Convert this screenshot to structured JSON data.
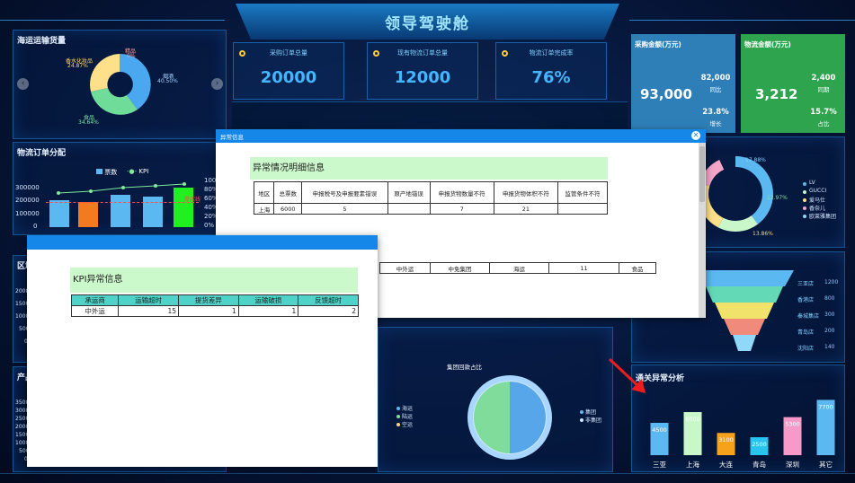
{
  "header": {
    "title": "领导驾驶舱"
  },
  "kpis": [
    {
      "label": "采购订单总量",
      "value": "20000"
    },
    {
      "label": "现有物流订单总量",
      "value": "12000"
    },
    {
      "label": "物流订单完成率",
      "value": "76%"
    }
  ],
  "money": {
    "purchase": {
      "title": "采购金额(万元)",
      "main": "93,000",
      "v1": "82,000",
      "c1": "同比",
      "v2": "23.8%",
      "c2": "增长",
      "color": "#2e7fb8"
    },
    "logistics": {
      "title": "物流金额(万元)",
      "main": "3,212",
      "v1": "2,400",
      "c1": "同期",
      "v2": "15.7%",
      "c2": "占比",
      "color": "#2ea44f"
    }
  },
  "shipping": {
    "title": "海运运输货量",
    "labels": [
      {
        "name": "精品",
        "pct": "0%"
      },
      {
        "name": "香水化妆品",
        "pct": "24.87%"
      },
      {
        "name": "烟酒",
        "pct": "40.50%"
      },
      {
        "name": "食品",
        "pct": "34.64%"
      }
    ]
  },
  "order_dist": {
    "title": "物流订单分配",
    "legend": [
      "票数",
      "KPI"
    ],
    "y_left": [
      "300000",
      "200000",
      "100000",
      "0"
    ],
    "y_right": [
      "100",
      "80%",
      "60%",
      "40%",
      "20%",
      "0%"
    ],
    "marker": "警戒线"
  },
  "cut_labels": {
    "region": "区域",
    "product": "产品"
  },
  "left_ticks_mid": [
    "2000",
    "1500",
    "1000",
    "500",
    "0"
  ],
  "left_ticks_bottom": [
    "3500",
    "3000",
    "2500",
    "2000",
    "1500",
    "1000",
    "500",
    "0"
  ],
  "brand_legend": [
    "LV",
    "GUCCI",
    "爱马仕",
    "香奈儿",
    "欧莱雅集团"
  ],
  "brand_pcts": [
    "17.88%",
    "12.97%",
    "13.86%"
  ],
  "funnel": [
    {
      "name": "三亚店",
      "value": "1200",
      "color": "#5cb8f0"
    },
    {
      "name": "香港店",
      "value": "800",
      "color": "#64d9b6"
    },
    {
      "name": "秦城集店",
      "value": "300",
      "color": "#f0e26a"
    },
    {
      "name": "青岛店",
      "value": "200",
      "color": "#f08a7a"
    },
    {
      "name": "沈阳店",
      "value": "140",
      "color": "#8fd8f8"
    }
  ],
  "customs": {
    "title": "通关异常分析",
    "chart_data": {
      "type": "bar",
      "title": "通关异常分析",
      "categories": [
        "三亚",
        "上海",
        "大连",
        "青岛",
        "深圳",
        "其它"
      ],
      "values": [
        4500,
        6000,
        3100,
        2500,
        5300,
        7700
      ],
      "colors": [
        "#5cb8f0",
        "#c9f7c9",
        "#f7a21b",
        "#28c4ee",
        "#f59ac9",
        "#5cb8f0"
      ],
      "ylim": [
        0,
        8000
      ]
    }
  },
  "group_pie": {
    "title": "集团回款占比",
    "left_legend": [
      "海运",
      "陆运",
      "空运"
    ],
    "right_legend": [
      "集团",
      "非集团"
    ]
  },
  "dialog_exception": {
    "bar_title": "异常信息",
    "section": "异常情况明细信息",
    "columns": [
      "地区",
      "总票数",
      "申报税号及申报要素错误",
      "原产地错误",
      "申报货物数量不符",
      "申报货物体积不符",
      "监管条件不符"
    ],
    "rows": [
      [
        "上海",
        "6000",
        "5",
        "",
        "7",
        "21",
        ""
      ]
    ],
    "lower_row": [
      "中外运",
      "中免集团",
      "海运",
      "11",
      "食品"
    ]
  },
  "dialog_kpi": {
    "section": "KPI异常信息",
    "columns": [
      "承运商",
      "运输超时",
      "提货差异",
      "运输破损",
      "反馈超时"
    ],
    "rows": [
      [
        "中外运",
        "15",
        "1",
        "1",
        "2"
      ]
    ]
  }
}
